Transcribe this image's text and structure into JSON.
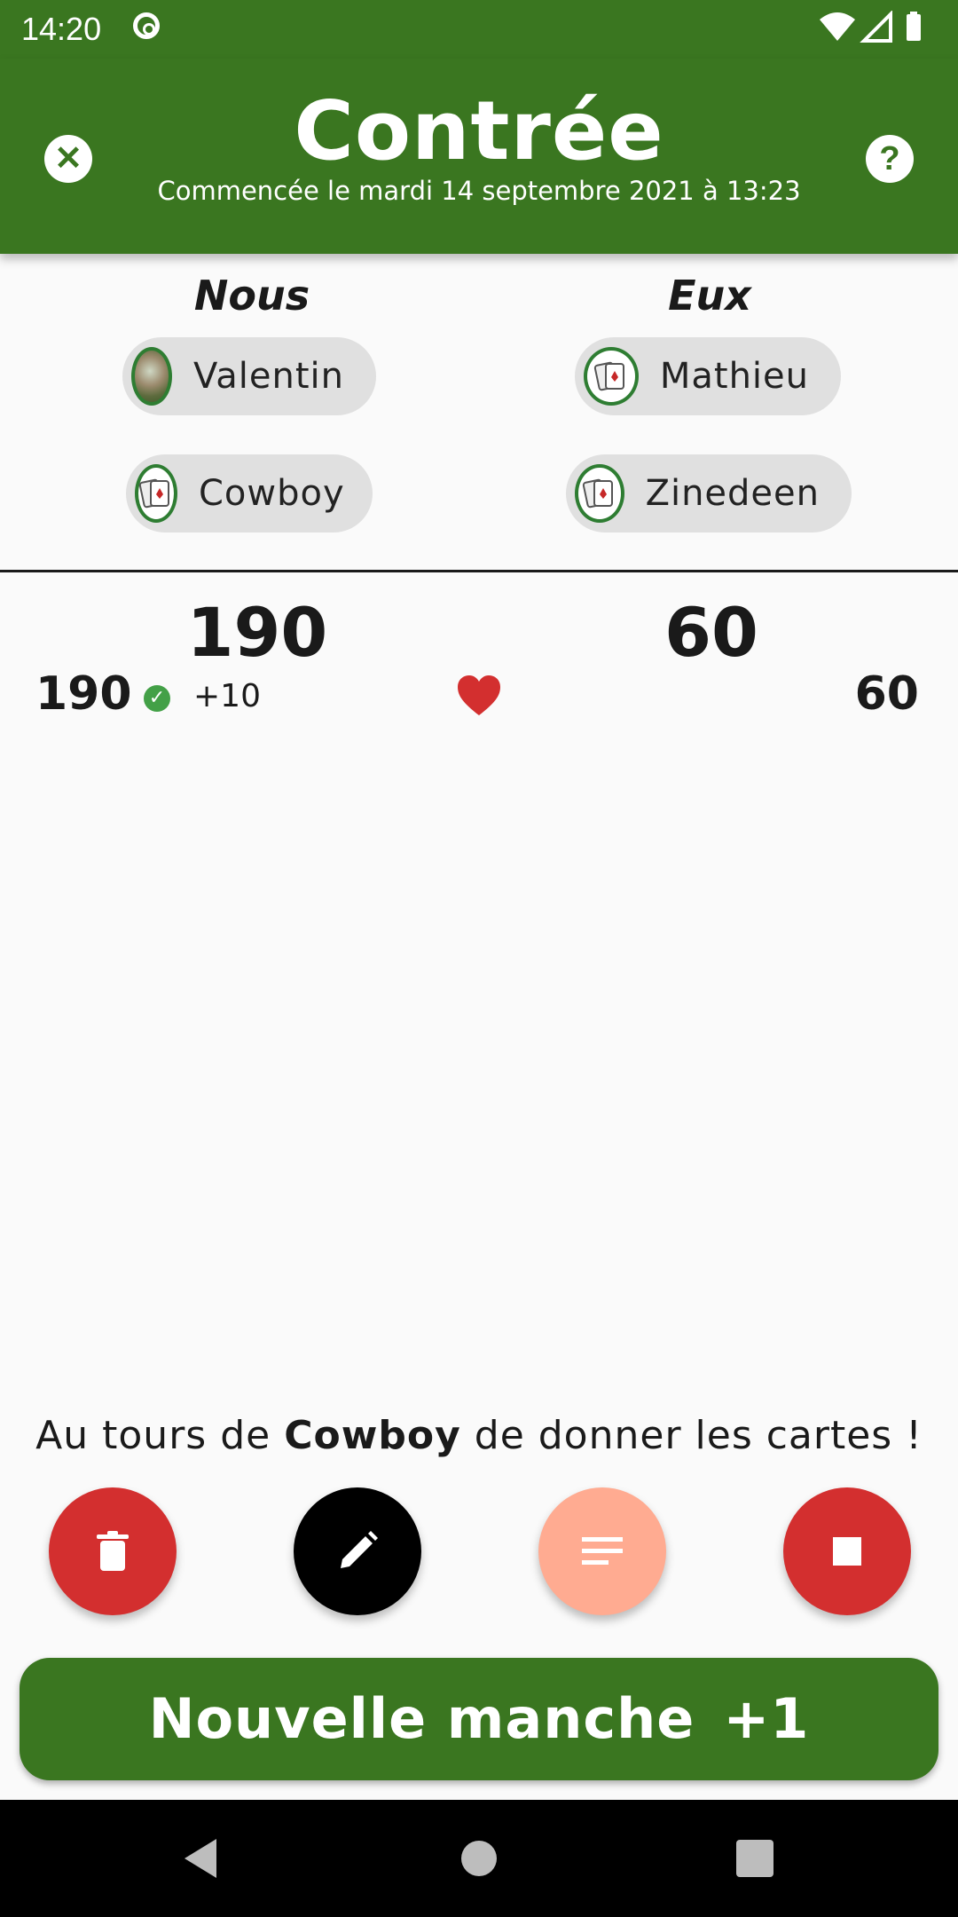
{
  "status_bar": {
    "time": "14:20"
  },
  "header": {
    "title": "Contrée",
    "subtitle": "Commencée le mardi 14 septembre 2021 à 13:23",
    "close_icon": "close-icon",
    "help_icon": "help-icon",
    "help_glyph": "?",
    "close_glyph": "✕"
  },
  "teams": {
    "us": {
      "name": "Nous",
      "players": [
        "Valentin",
        "Cowboy"
      ]
    },
    "them": {
      "name": "Eux",
      "players": [
        "Mathieu",
        "Zinedeen"
      ]
    }
  },
  "scores": {
    "us_total": "190",
    "them_total": "60",
    "round": {
      "us": "190",
      "them": "60",
      "bonus": "+10",
      "trump_icon": "heart-icon"
    }
  },
  "dealer": {
    "prefix": "Au tours de",
    "name": "Cowboy",
    "suffix": "de donner les cartes !"
  },
  "actions": {
    "delete": {
      "icon": "trash-icon",
      "color": "#d32f2f"
    },
    "edit": {
      "icon": "pencil-icon",
      "color": "#000000"
    },
    "notes": {
      "icon": "notes-icon",
      "color": "#ffab91"
    },
    "stop": {
      "icon": "stop-icon",
      "color": "#d32f2f"
    }
  },
  "new_round_button": {
    "label": "Nouvelle manche",
    "badge": "+1"
  },
  "colors": {
    "primary": "#3a7620",
    "danger": "#d32f2f",
    "accent": "#ffab91"
  }
}
